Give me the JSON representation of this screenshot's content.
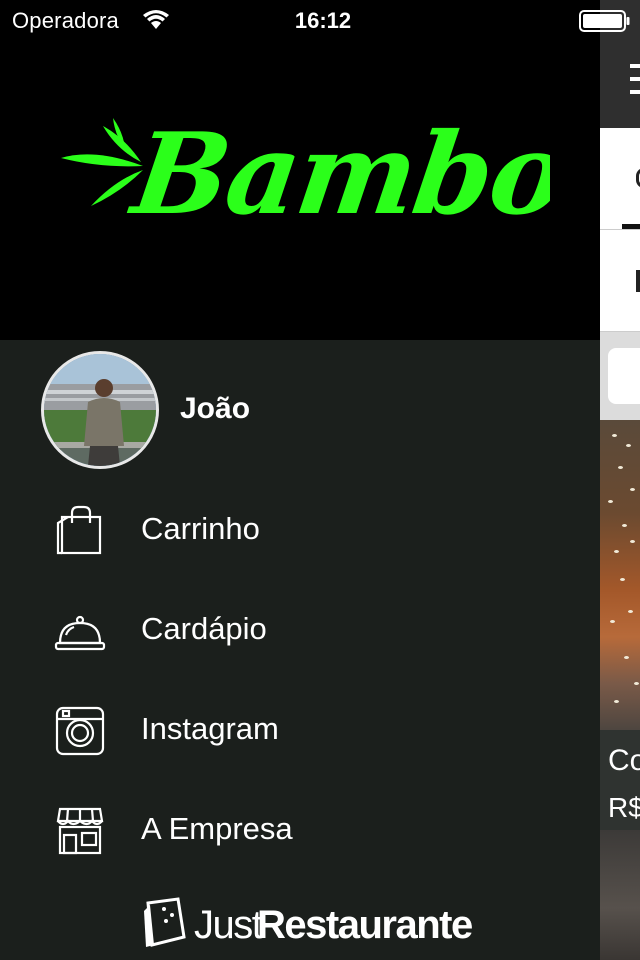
{
  "status_bar": {
    "carrier": "Operadora",
    "time": "16:12",
    "wifi_icon": "wifi-icon",
    "battery_icon": "battery-full-icon"
  },
  "drawer": {
    "brand": {
      "logo_text": "Bamboo",
      "logo_color": "#2bff1a",
      "logo_icon": "bamboo-leaves-icon"
    },
    "user": {
      "name": "João",
      "avatar_icon": "avatar-photo"
    },
    "menu_items": [
      {
        "label": "Carrinho",
        "icon": "shopping-bag-icon"
      },
      {
        "label": "Cardápio",
        "icon": "food-cloche-icon"
      },
      {
        "label": "Instagram",
        "icon": "instagram-icon"
      },
      {
        "label": "A Empresa",
        "icon": "storefront-icon"
      }
    ],
    "footer": {
      "just": "Just",
      "restaurante": "Restaurante",
      "icon": "menu-card-icon"
    },
    "background_color": "#1b1f1c"
  },
  "main_peek": {
    "card_name": "Co",
    "card_price": "R$"
  }
}
